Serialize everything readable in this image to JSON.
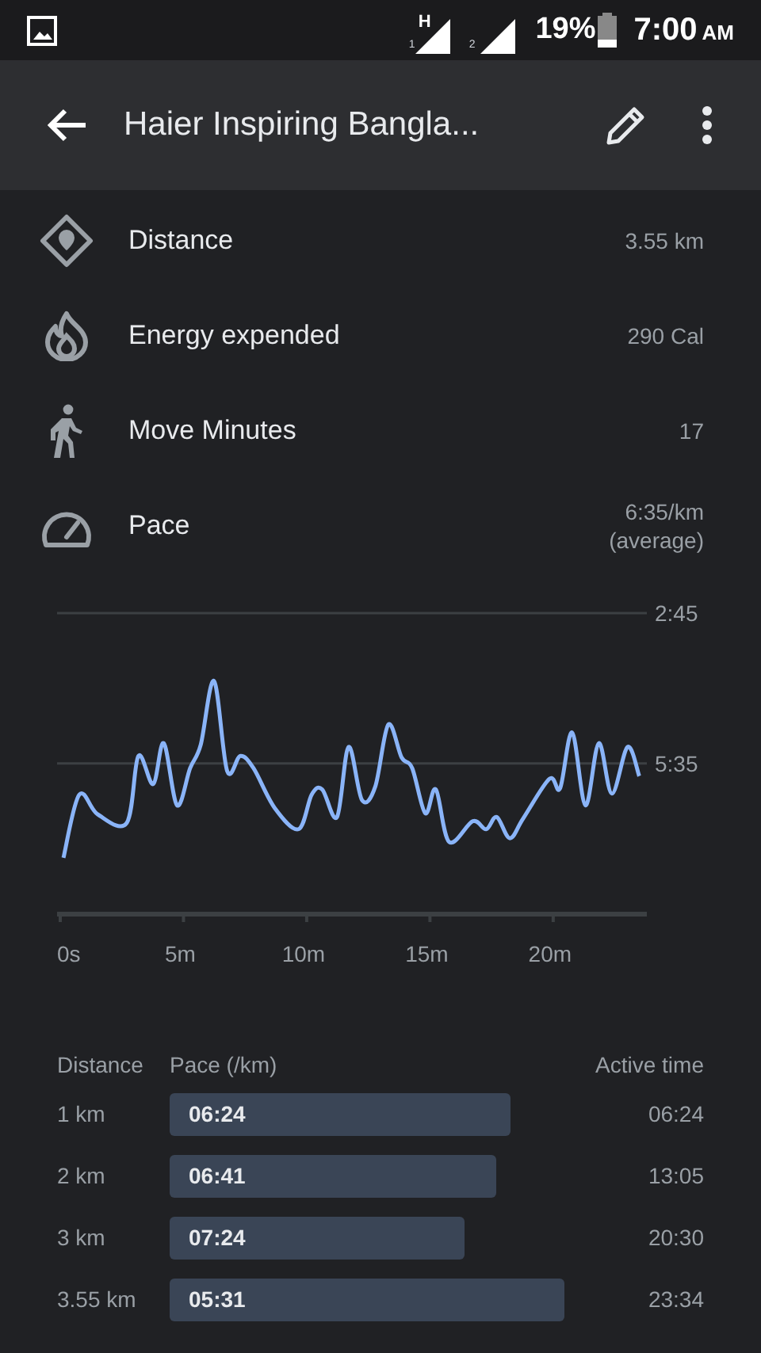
{
  "status_bar": {
    "sim1_network": "H",
    "sim1_label": "1",
    "sim2_label": "2",
    "battery": "19%",
    "time": "7:00",
    "time_suffix": "AM"
  },
  "app_bar": {
    "title": "Haier Inspiring Bangla..."
  },
  "stats": [
    {
      "kind": "distance",
      "label": "Distance",
      "value": "3.55 km"
    },
    {
      "kind": "energy",
      "label": "Energy expended",
      "value": "290 Cal"
    },
    {
      "kind": "move",
      "label": "Move Minutes",
      "value": "17"
    },
    {
      "kind": "pace",
      "label": "Pace",
      "value": "6:35/km",
      "note": "(average)"
    }
  ],
  "pace_chart": {
    "chart_data": {
      "type": "line",
      "ylim": [
        8.42,
        2.75
      ],
      "xlim": [
        0,
        23.8
      ],
      "xticks": [
        {
          "value": 0,
          "label": "0s"
        },
        {
          "value": 5,
          "label": "5m"
        },
        {
          "value": 10,
          "label": "10m"
        },
        {
          "value": 15,
          "label": "15m"
        },
        {
          "value": 20,
          "label": "20m"
        }
      ],
      "yticks": [
        {
          "value": 2.75,
          "label": "2:45"
        },
        {
          "value": 5.583,
          "label": "5:35"
        }
      ],
      "x": [
        0.13,
        0.77,
        1.52,
        2.7,
        3.17,
        3.77,
        4.2,
        4.74,
        5.27,
        5.7,
        6.24,
        6.77,
        7.31,
        7.84,
        8.7,
        9.67,
        10.2,
        10.63,
        11.23,
        11.7,
        12.24,
        12.78,
        13.31,
        13.85,
        14.28,
        14.81,
        15.24,
        15.78,
        16.74,
        17.28,
        17.71,
        18.24,
        18.78,
        19.85,
        20.28,
        20.77,
        21.31,
        21.85,
        22.38,
        23.02,
        23.49
      ],
      "series": [
        {
          "color": "#8ab4f8",
          "values": [
            7.36,
            6.17,
            6.54,
            6.7,
            5.44,
            5.97,
            5.2,
            6.37,
            5.67,
            5.23,
            4.03,
            5.72,
            5.44,
            5.67,
            6.42,
            6.82,
            6.17,
            6.07,
            6.59,
            5.27,
            6.27,
            6.02,
            4.85,
            5.47,
            5.67,
            6.52,
            6.07,
            7.06,
            6.67,
            6.82,
            6.59,
            6.99,
            6.62,
            5.87,
            6.05,
            5.0,
            6.37,
            5.2,
            6.15,
            5.27,
            5.82
          ]
        }
      ]
    }
  },
  "splits": {
    "columns": [
      "Distance",
      "Pace (/km)",
      "Active time"
    ],
    "rows": [
      {
        "distance": "1 km",
        "pace": "06:24",
        "active_time": "06:24"
      },
      {
        "distance": "2 km",
        "pace": "06:41",
        "active_time": "13:05"
      },
      {
        "distance": "3 km",
        "pace": "07:24",
        "active_time": "20:30"
      },
      {
        "distance": "3.55 km",
        "pace": "05:31",
        "active_time": "23:34"
      }
    ]
  }
}
